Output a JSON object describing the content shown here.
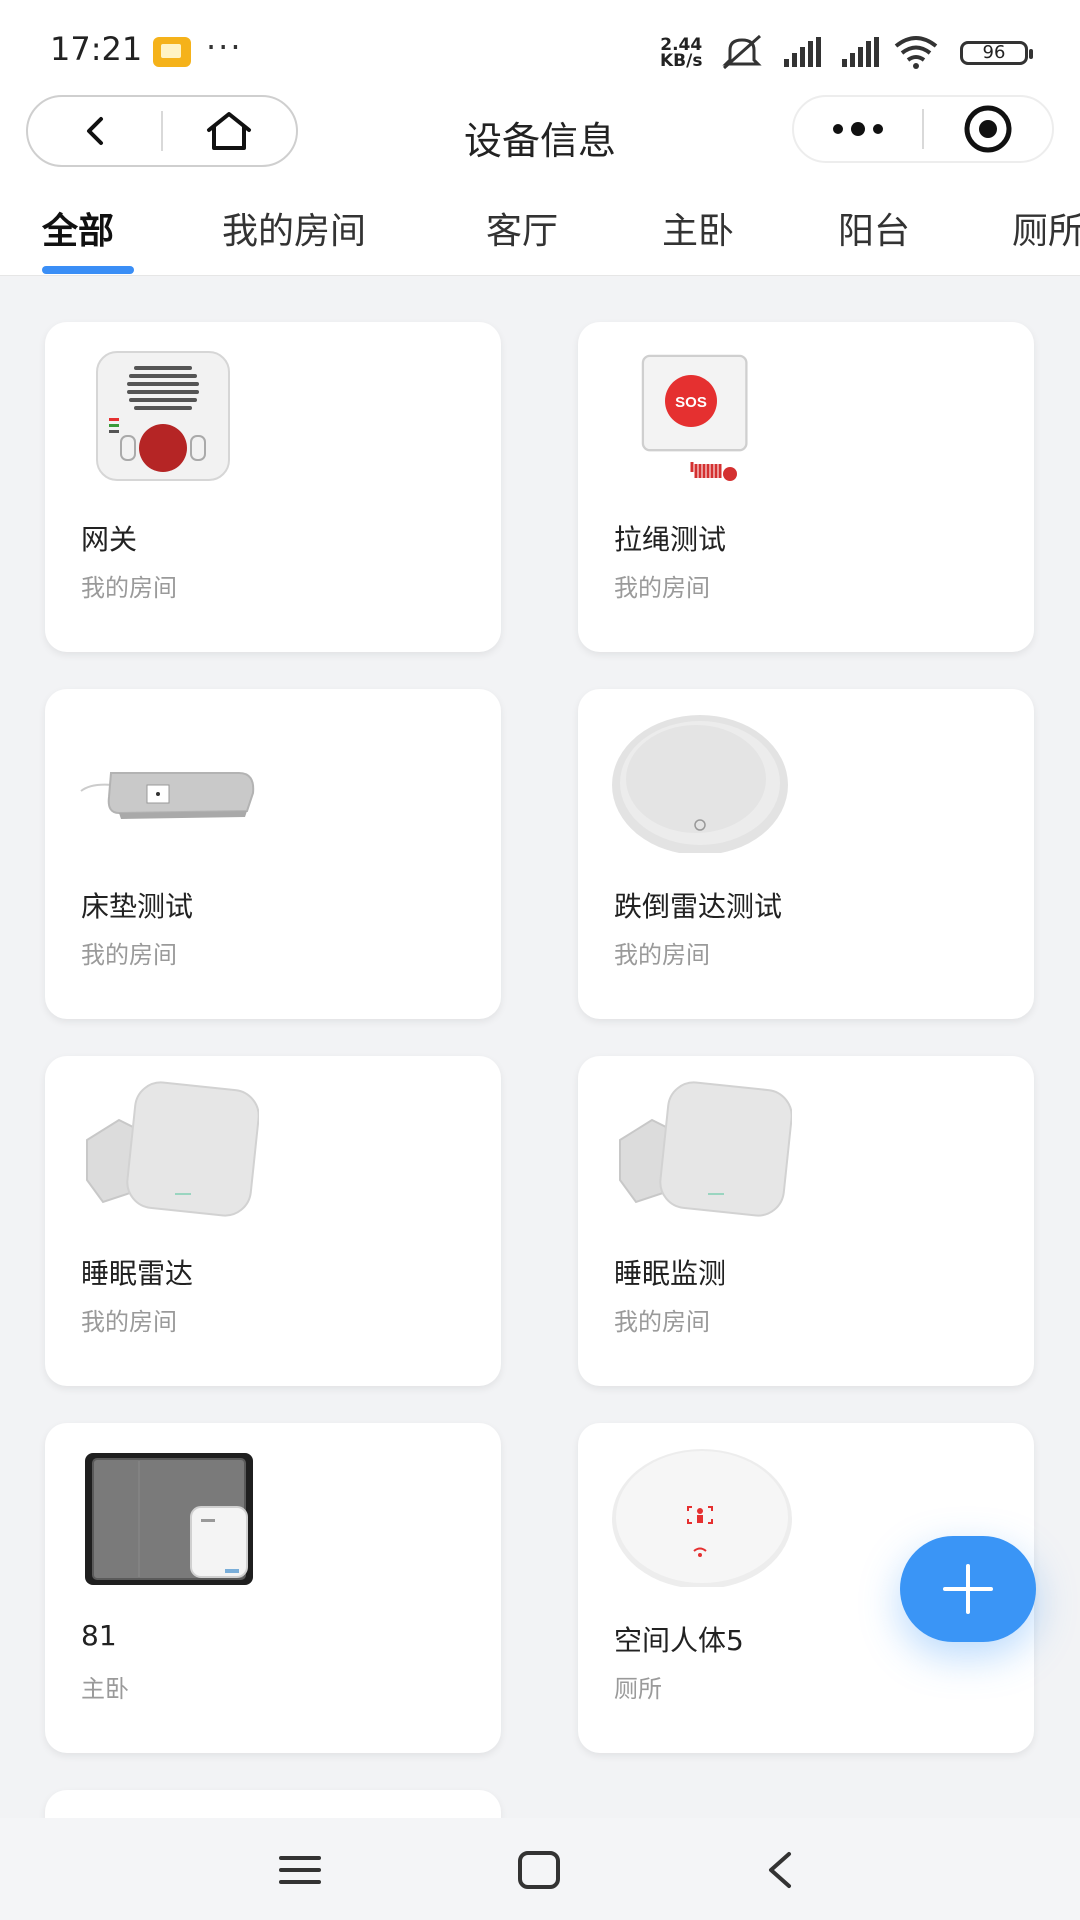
{
  "status_bar": {
    "time": "17:21",
    "dots": "···",
    "speed_value": "2.44",
    "speed_unit": "KB/s",
    "battery": "96"
  },
  "title_bar": {
    "title": "设备信息"
  },
  "tabs": [
    {
      "label": "全部",
      "active": true
    },
    {
      "label": "我的房间",
      "active": false
    },
    {
      "label": "客厅",
      "active": false
    },
    {
      "label": "主卧",
      "active": false
    },
    {
      "label": "阳台",
      "active": false
    },
    {
      "label": "厕所",
      "active": false
    }
  ],
  "devices": [
    {
      "name": "网关",
      "room": "我的房间",
      "icon": "gateway-device-icon"
    },
    {
      "name": "拉绳测试",
      "room": "我的房间",
      "icon": "sos-pull-cord-icon",
      "icon_text": "SOS"
    },
    {
      "name": "床垫测试",
      "room": "我的房间",
      "icon": "mattress-pad-icon"
    },
    {
      "name": "跌倒雷达测试",
      "room": "我的房间",
      "icon": "fall-radar-icon"
    },
    {
      "name": "睡眠雷达",
      "room": "我的房间",
      "icon": "sleep-radar-icon"
    },
    {
      "name": "睡眠监测",
      "room": "我的房间",
      "icon": "sleep-monitor-icon"
    },
    {
      "name": "81",
      "room": "主卧",
      "icon": "mattress-kit-icon"
    },
    {
      "name": "空间人体5",
      "room": "厕所",
      "icon": "presence-sensor-icon"
    }
  ],
  "colors": {
    "accent": "#3a95f6",
    "background": "#f2f3f5",
    "sos_red": "#e53030"
  }
}
